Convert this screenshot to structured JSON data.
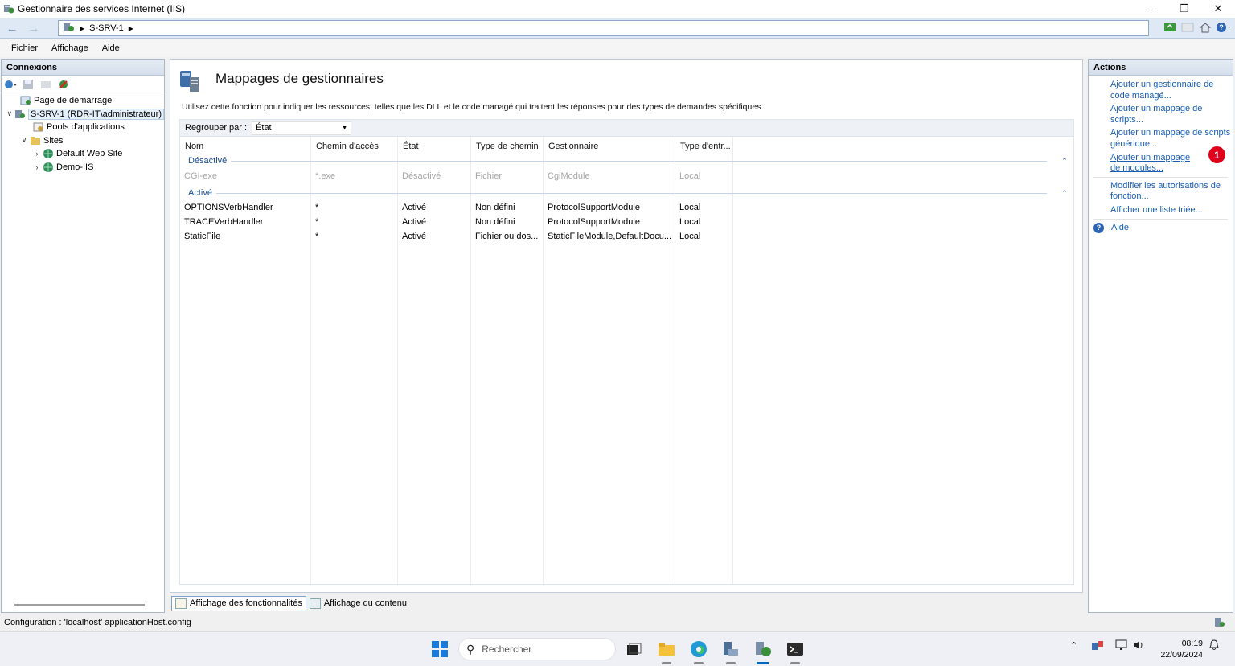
{
  "window": {
    "title": "Gestionnaire des services Internet (IIS)",
    "controls": [
      "minimize-icon",
      "restore-icon",
      "close-icon"
    ]
  },
  "address": {
    "path_item": "S-SRV-1"
  },
  "menu": {
    "items": [
      "Fichier",
      "Affichage",
      "Aide"
    ]
  },
  "connections": {
    "header": "Connexions",
    "tree": {
      "start_page": "Page de démarrage",
      "server": "S-SRV-1 (RDR-IT\\administrateur)",
      "app_pools": "Pools d'applications",
      "sites": "Sites",
      "site1": "Default Web Site",
      "site2": "Demo-IIS"
    }
  },
  "main": {
    "title": "Mappages de gestionnaires",
    "description": "Utilisez cette fonction pour indiquer les ressources, telles que les DLL et le code managé qui traitent les réponses pour des types de demandes spécifiques.",
    "group_by_label": "Regrouper par :",
    "group_by_value": "État",
    "columns": [
      "Nom",
      "Chemin d'accès",
      "État",
      "Type de chemin",
      "Gestionnaire",
      "Type d'entr..."
    ],
    "groups": {
      "disabled": {
        "name": "Désactivé",
        "rows": [
          {
            "name": "CGI-exe",
            "path": "*.exe",
            "state": "Désactivé",
            "path_type": "Fichier",
            "handler": "CgiModule",
            "entry_type": "Local"
          }
        ]
      },
      "enabled": {
        "name": "Activé",
        "rows": [
          {
            "name": "OPTIONSVerbHandler",
            "path": "*",
            "state": "Activé",
            "path_type": "Non défini",
            "handler": "ProtocolSupportModule",
            "entry_type": "Local"
          },
          {
            "name": "TRACEVerbHandler",
            "path": "*",
            "state": "Activé",
            "path_type": "Non défini",
            "handler": "ProtocolSupportModule",
            "entry_type": "Local"
          },
          {
            "name": "StaticFile",
            "path": "*",
            "state": "Activé",
            "path_type": "Fichier ou dos...",
            "handler": "StaticFileModule,DefaultDocu...",
            "entry_type": "Local"
          }
        ]
      }
    },
    "view_tabs": {
      "features": "Affichage des fonctionnalités",
      "content": "Affichage du contenu"
    }
  },
  "actions": {
    "header": "Actions",
    "links": {
      "add_managed": "Ajouter un gestionnaire de code managé...",
      "add_script": "Ajouter un mappage de scripts...",
      "add_wildcard": "Ajouter un mappage de scripts générique...",
      "add_module": "Ajouter un mappage de modules...",
      "edit_permissions": "Modifier les autorisations de fonction...",
      "show_sorted": "Afficher une liste triée..."
    },
    "help": "Aide",
    "badge_number": "1",
    "badge_color": "#e1001a"
  },
  "status": {
    "text": "Configuration : 'localhost' applicationHost.config"
  },
  "taskbar": {
    "search_placeholder": "Rechercher",
    "time": "08:19",
    "date": "22/09/2024"
  }
}
